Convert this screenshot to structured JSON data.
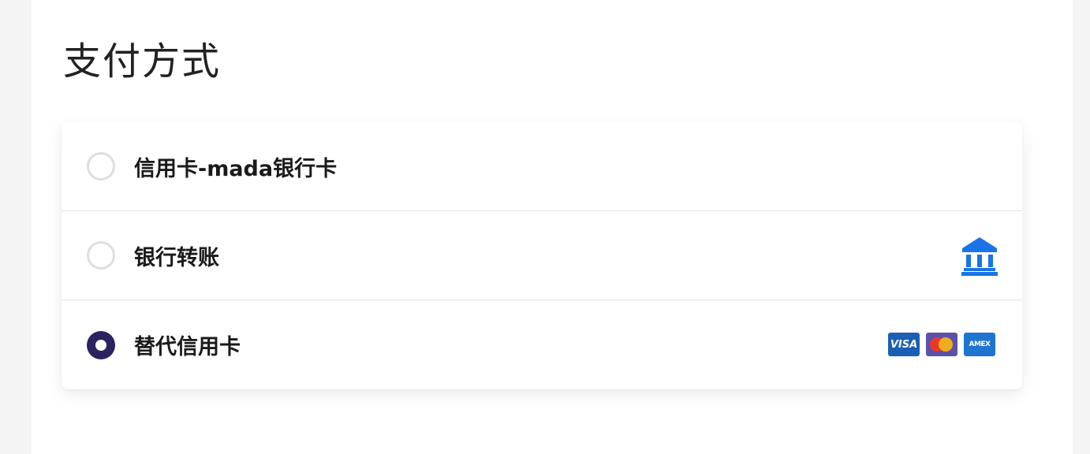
{
  "page": {
    "title": "支付方式"
  },
  "payment_methods": [
    {
      "label": "信用卡-mada银行卡",
      "selected": false,
      "icon": null
    },
    {
      "label": "银行转账",
      "selected": false,
      "icon": "bank-icon"
    },
    {
      "label": "替代信用卡",
      "selected": true,
      "icons": [
        "visa-icon",
        "mastercard-icon",
        "amex-icon"
      ]
    }
  ],
  "card_logos": {
    "visa": "VISA",
    "amex": "AMEX"
  },
  "colors": {
    "accent": "#2a2360",
    "bank_icon": "#1a73e8",
    "visa": "#1a5fb4",
    "mastercard_bg": "#5b52a8",
    "amex": "#1f74d0"
  }
}
